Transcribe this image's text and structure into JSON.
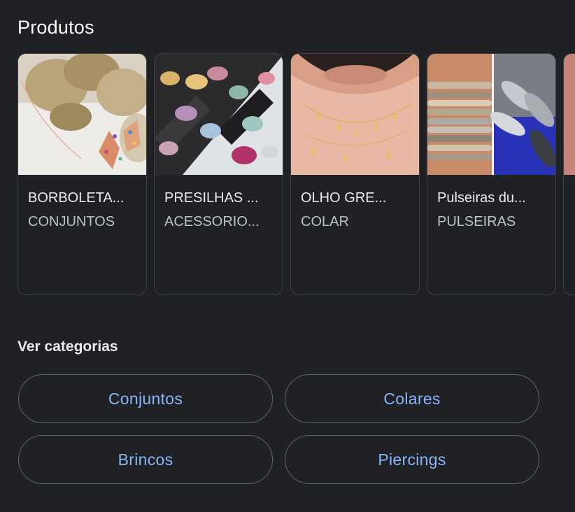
{
  "section_title": "Produtos",
  "products": [
    {
      "name": "BORBOLETA...",
      "category": "CONJUNTOS",
      "image": "butterfly-jewelry-set"
    },
    {
      "name": "PRESILHAS ...",
      "category": "ACESSORIO...",
      "image": "butterfly-hair-clips"
    },
    {
      "name": "OLHO GRE...",
      "category": "COLAR",
      "image": "gold-necklace"
    },
    {
      "name": "Pulseiras du...",
      "category": "PULSEIRAS",
      "image": "bangle-bracelets"
    }
  ],
  "categories_title": "Ver categorias",
  "categories": [
    "Conjuntos",
    "Colares",
    "Brincos",
    "Piercings"
  ],
  "colors": {
    "background": "#202124",
    "link": "#8ab4f8",
    "card_border": "#3c4043",
    "chip_border": "#5f6368"
  }
}
